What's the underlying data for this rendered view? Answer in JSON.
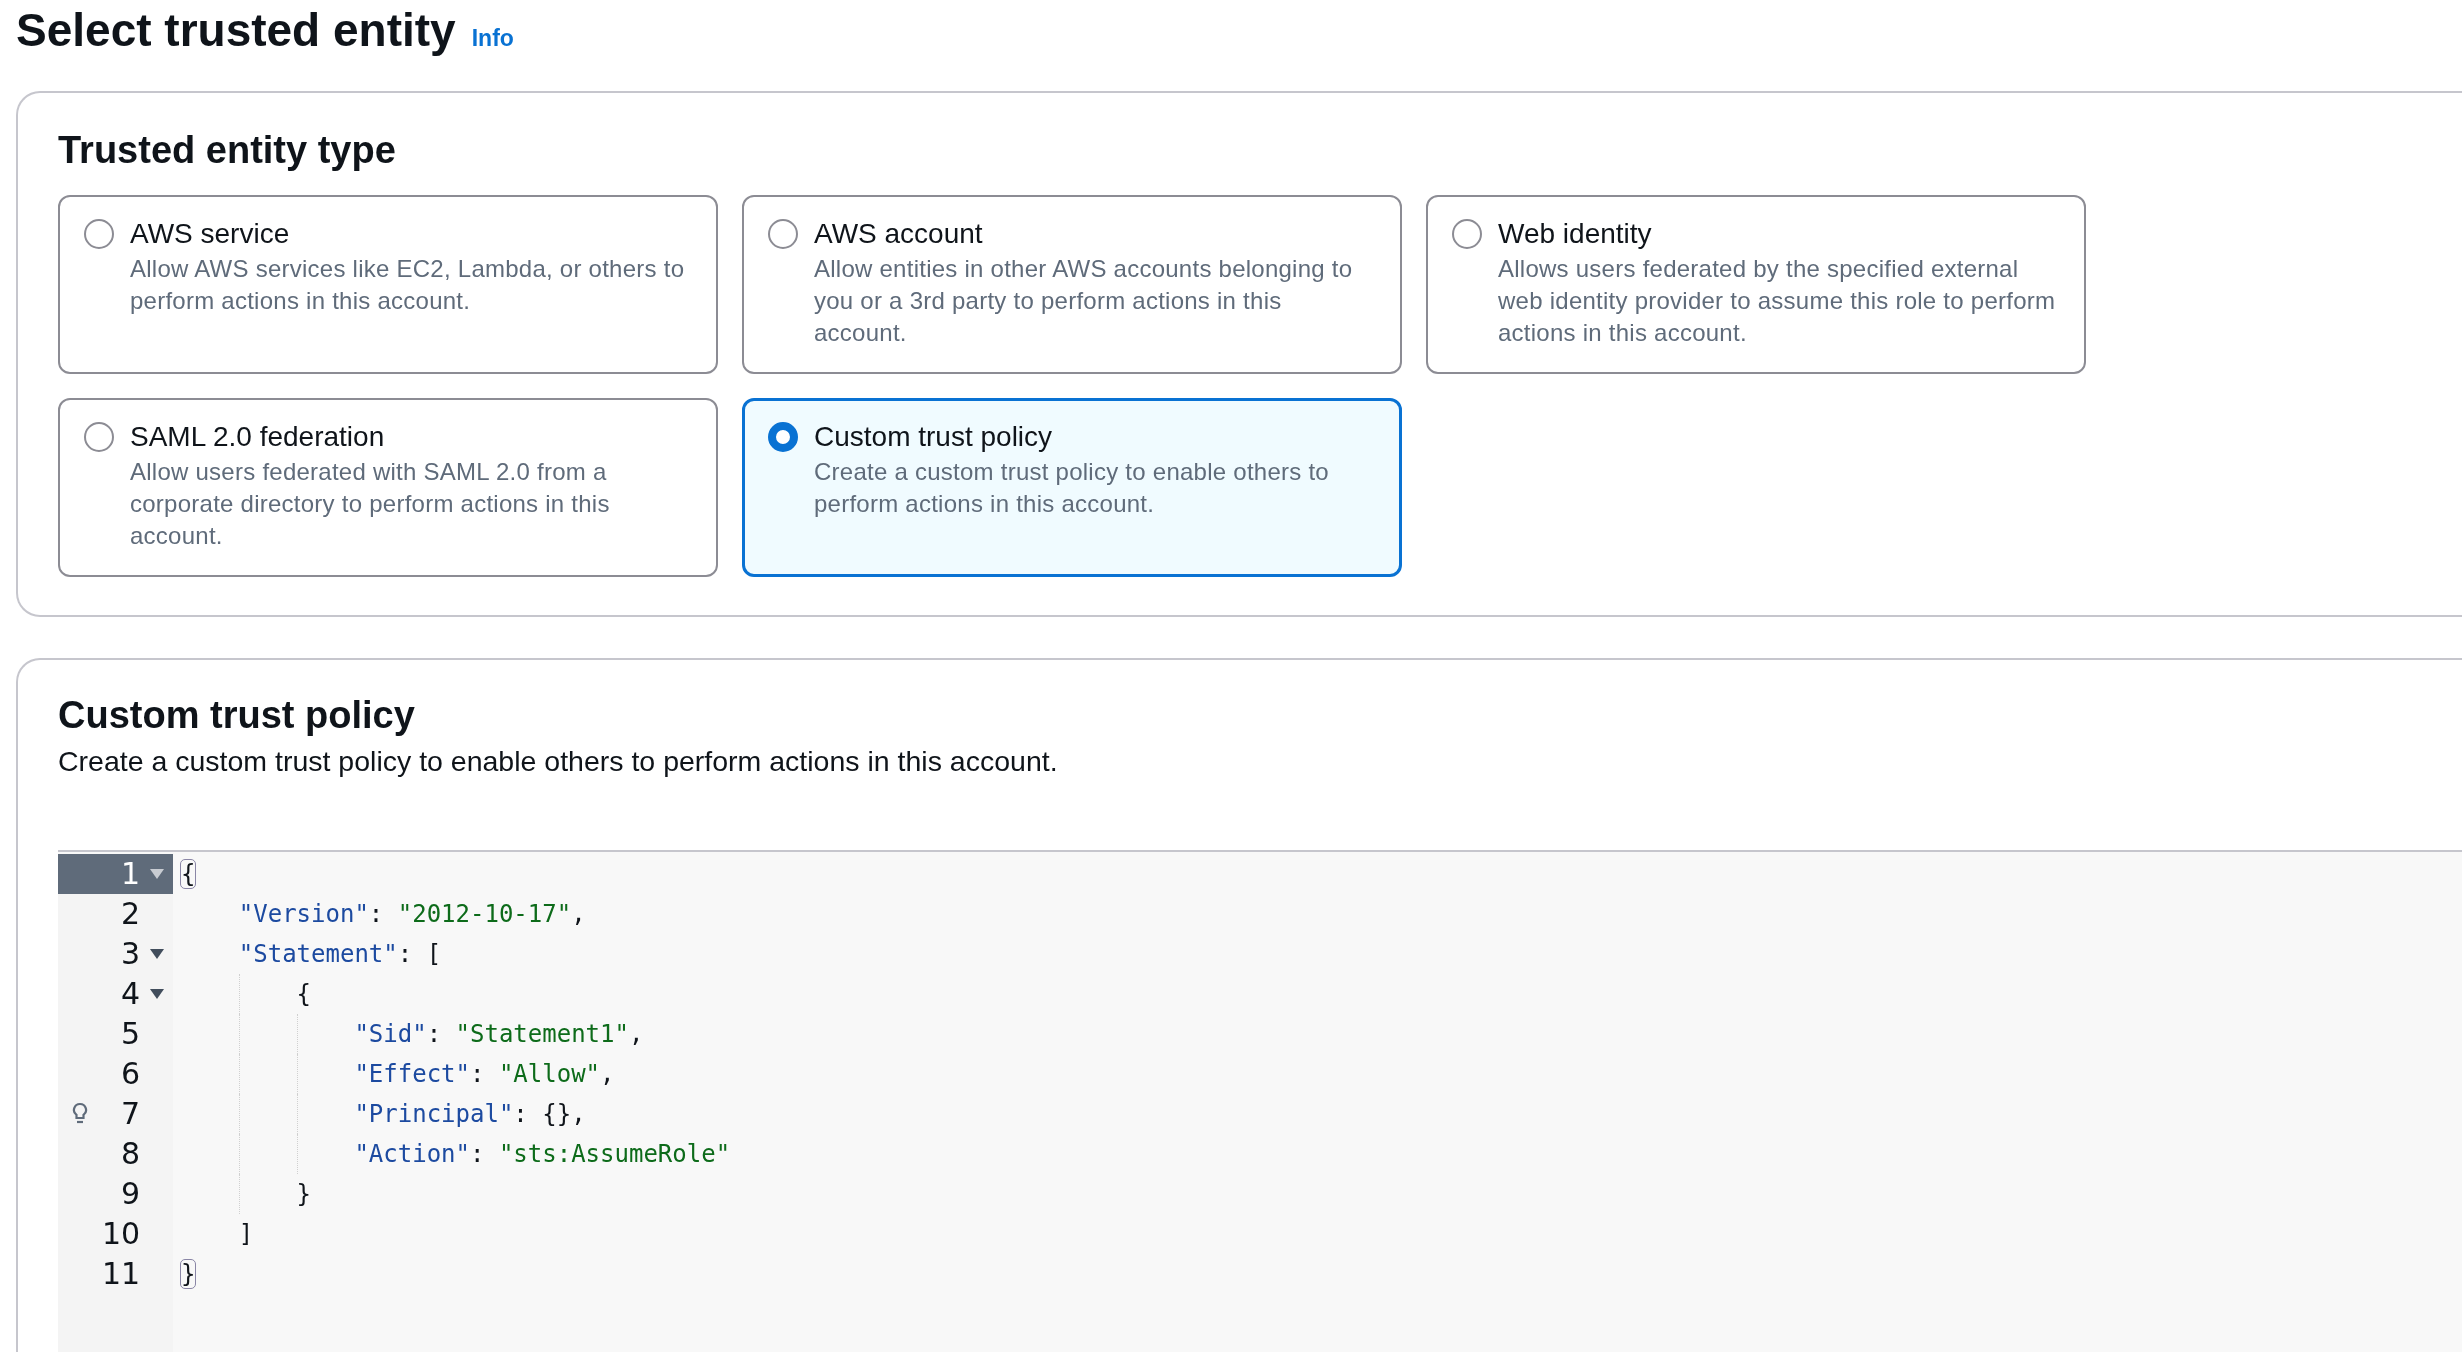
{
  "header": {
    "title": "Select trusted entity",
    "info_link": "Info"
  },
  "entity_type": {
    "title": "Trusted entity type",
    "options": [
      {
        "title": "AWS service",
        "description": "Allow AWS services like EC2, Lambda, or others to perform actions in this account.",
        "selected": false
      },
      {
        "title": "AWS account",
        "description": "Allow entities in other AWS accounts belonging to you or a 3rd party to perform actions in this account.",
        "selected": false
      },
      {
        "title": "Web identity",
        "description": "Allows users federated by the specified external web identity provider to assume this role to perform actions in this account.",
        "selected": false
      },
      {
        "title": "SAML 2.0 federation",
        "description": "Allow users federated with SAML 2.0 from a corporate directory to perform actions in this account.",
        "selected": false
      },
      {
        "title": "Custom trust policy",
        "description": "Create a custom trust policy to enable others to perform actions in this account.",
        "selected": true
      }
    ]
  },
  "policy": {
    "title": "Custom trust policy",
    "description": "Create a custom trust policy to enable others to perform actions in this account.",
    "editor": {
      "lines": [
        {
          "number": "1",
          "active": true,
          "foldable": true,
          "hint": false,
          "bracket_match": true,
          "tokens": [
            {
              "kind": "punct",
              "text": "{"
            }
          ]
        },
        {
          "number": "2",
          "active": false,
          "foldable": false,
          "hint": false,
          "bracket_match": false,
          "tokens": [
            {
              "kind": "key",
              "text": "    \"Version\""
            },
            {
              "kind": "punct",
              "text": ": "
            },
            {
              "kind": "string",
              "text": "\"2012-10-17\""
            },
            {
              "kind": "punct",
              "text": ","
            }
          ]
        },
        {
          "number": "3",
          "active": false,
          "foldable": true,
          "hint": false,
          "bracket_match": false,
          "tokens": [
            {
              "kind": "key",
              "text": "    \"Statement\""
            },
            {
              "kind": "punct",
              "text": ": ["
            }
          ]
        },
        {
          "number": "4",
          "active": false,
          "foldable": true,
          "hint": false,
          "bracket_match": false,
          "tokens": [
            {
              "kind": "punct",
              "text": "        {"
            }
          ]
        },
        {
          "number": "5",
          "active": false,
          "foldable": false,
          "hint": false,
          "bracket_match": false,
          "tokens": [
            {
              "kind": "key",
              "text": "            \"Sid\""
            },
            {
              "kind": "punct",
              "text": ": "
            },
            {
              "kind": "string",
              "text": "\"Statement1\""
            },
            {
              "kind": "punct",
              "text": ","
            }
          ]
        },
        {
          "number": "6",
          "active": false,
          "foldable": false,
          "hint": false,
          "bracket_match": false,
          "tokens": [
            {
              "kind": "key",
              "text": "            \"Effect\""
            },
            {
              "kind": "punct",
              "text": ": "
            },
            {
              "kind": "string",
              "text": "\"Allow\""
            },
            {
              "kind": "punct",
              "text": ","
            }
          ]
        },
        {
          "number": "7",
          "active": false,
          "foldable": false,
          "hint": true,
          "bracket_match": false,
          "tokens": [
            {
              "kind": "key",
              "text": "            \"Principal\""
            },
            {
              "kind": "punct",
              "text": ": {},"
            }
          ]
        },
        {
          "number": "8",
          "active": false,
          "foldable": false,
          "hint": false,
          "bracket_match": false,
          "tokens": [
            {
              "kind": "key",
              "text": "            \"Action\""
            },
            {
              "kind": "punct",
              "text": ": "
            },
            {
              "kind": "string",
              "text": "\"sts:AssumeRole\""
            }
          ]
        },
        {
          "number": "9",
          "active": false,
          "foldable": false,
          "hint": false,
          "bracket_match": false,
          "tokens": [
            {
              "kind": "punct",
              "text": "        }"
            }
          ]
        },
        {
          "number": "10",
          "active": false,
          "foldable": false,
          "hint": false,
          "bracket_match": false,
          "tokens": [
            {
              "kind": "punct",
              "text": "    ]"
            }
          ]
        },
        {
          "number": "11",
          "active": false,
          "foldable": false,
          "hint": false,
          "bracket_match": true,
          "tokens": [
            {
              "kind": "punct",
              "text": "}"
            }
          ]
        }
      ]
    }
  }
}
